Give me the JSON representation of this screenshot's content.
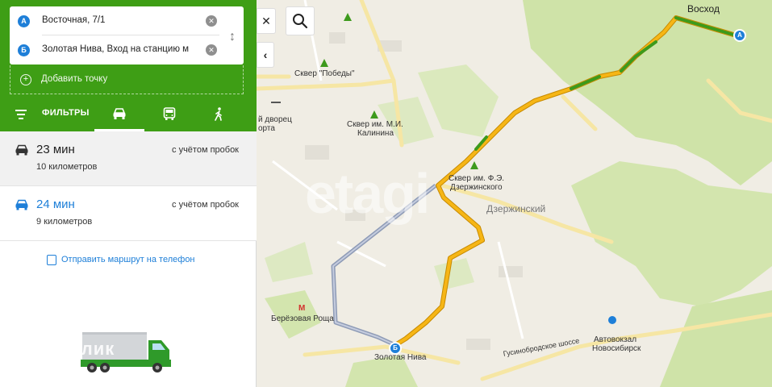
{
  "route_form": {
    "point_a": {
      "badge": "А",
      "value": "Восточная, 7/1"
    },
    "point_b": {
      "badge": "Б",
      "value": "Золотая Нива, Вход на станцию м"
    },
    "add_point": "Добавить точку"
  },
  "tabs": {
    "filters": "ФИЛЬТРЫ",
    "modes": [
      "car-icon",
      "bus-icon",
      "walk-icon"
    ],
    "active_mode": "car"
  },
  "routes": [
    {
      "time": "23 мин",
      "distance": "10 километров",
      "traffic": "с учётом пробок"
    },
    {
      "time": "24 мин",
      "distance": "9 километров",
      "traffic": "с учётом пробок"
    }
  ],
  "send_to_phone": "Отправить маршрут на телефон",
  "watermark": "ДомКлик",
  "map": {
    "watermark": "etagi",
    "labels": {
      "voshod": "Восход",
      "skver_pobedy": "Сквер \"Победы\"",
      "skver_kalinina_1": "Сквер им. М.И.",
      "skver_kalinina_2": "Калинина",
      "skver_dzerzh_1": "Сквер им. Ф.Э.",
      "skver_dzerzh_2": "Дзержинского",
      "dzerzhinsky": "Дзержинский",
      "dvorec_1": "й дворец",
      "dvorec_2": "орта",
      "berezovaya": "Берёзовая Роща",
      "metro": "М",
      "zolotaya": "Золотая Нива",
      "gusinobrod": "Гусинобродское шоссе",
      "avtovokzal_1": "Автовокзал",
      "avtovokzal_2": "Новосибирск"
    },
    "marker_a": "А",
    "marker_b": "Б"
  },
  "colors": {
    "panel_green": "#3e9e15",
    "accent_blue": "#1e7fd8",
    "route_yellow": "#f6b616",
    "route_green": "#3d9a1c"
  }
}
